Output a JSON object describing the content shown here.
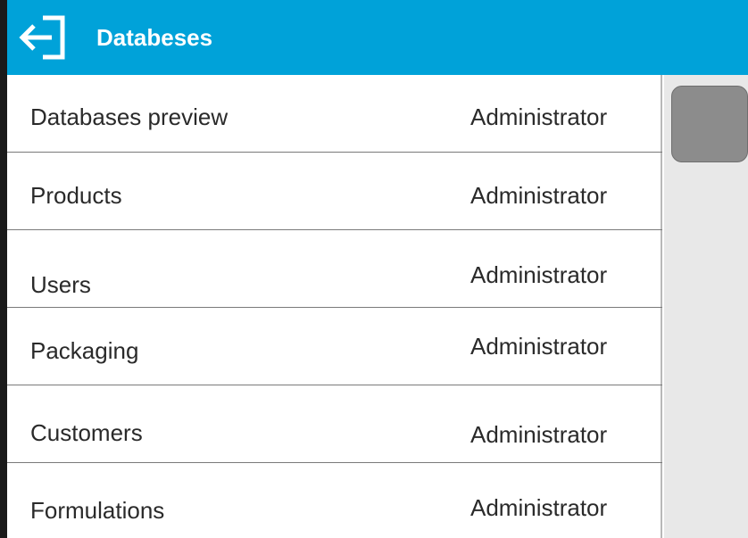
{
  "header": {
    "title": "Databeses",
    "back_icon": "exit-arrow-icon",
    "background_color": "#00a2d9"
  },
  "menu": {
    "items": [
      {
        "label": "Databases preview",
        "role": "Administrator"
      },
      {
        "label": "Products",
        "role": "Administrator"
      },
      {
        "label": "Users",
        "role": "Administrator"
      },
      {
        "label": "Packaging",
        "role": "Administrator"
      },
      {
        "label": "Customers",
        "role": "Administrator"
      },
      {
        "label": "Formulations",
        "role": "Administrator"
      }
    ]
  },
  "scrollbar": {
    "thumb_color": "#8c8c8c",
    "track_color": "#e8e8e8"
  }
}
